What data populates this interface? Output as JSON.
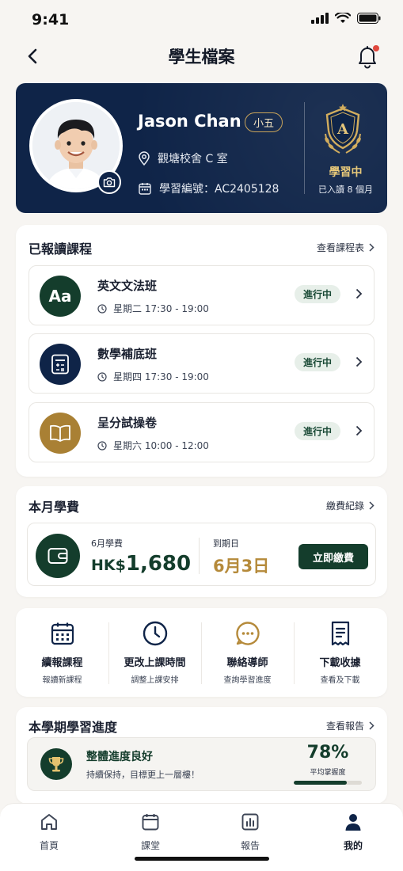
{
  "status_bar": {
    "time": "9:41"
  },
  "nav": {
    "title": "學生檔案"
  },
  "profile": {
    "name": "Jason Chan",
    "grade": "小五",
    "campus": "觀塘校舍 C 室",
    "student_id": "學習編號：AC2405128",
    "status": "學習中",
    "enrolled": "已入讀 8 個月"
  },
  "courses": {
    "title": "已報讀課程",
    "link": "查看課程表",
    "items": [
      {
        "icon_text": "Aa",
        "name": "英文文法班",
        "time": "星期二 17:30 - 19:00",
        "status": "進行中",
        "color": "#143d2c"
      },
      {
        "name": "數學補底班",
        "time": "星期四 17:30 - 19:00",
        "status": "進行中",
        "color": "#0f2448"
      },
      {
        "name": "呈分試操卷",
        "time": "星期六 10:00 - 12:00",
        "status": "進行中",
        "color": "#a98034"
      }
    ]
  },
  "fees": {
    "title": "本月學費",
    "link": "繳費紀錄",
    "month_label": "6月學費",
    "currency": "HK$",
    "amount": "1,680",
    "due_label": "到期日",
    "due_date": "6月3日",
    "pay_label": "立即繳費"
  },
  "actions": [
    {
      "title": "續報課程",
      "sub": "報讀新課程",
      "icon": "calendar-icon"
    },
    {
      "title": "更改上課時間",
      "sub": "調整上課安排",
      "icon": "clock-icon"
    },
    {
      "title": "聯絡導師",
      "sub": "查詢學習進度",
      "icon": "chat-icon"
    },
    {
      "title": "下載收據",
      "sub": "查看及下載",
      "icon": "receipt-icon"
    }
  ],
  "progress": {
    "title": "本學期學習進度",
    "link": "查看報告",
    "headline": "整體進度良好",
    "sub": "持續保持，目標更上一層樓！",
    "percent_text": "78%",
    "percent_value": 0.78,
    "percent_label": "平均掌握度"
  },
  "tabs": [
    {
      "label": "首頁"
    },
    {
      "label": "課堂"
    },
    {
      "label": "報告"
    },
    {
      "label": "我的"
    }
  ],
  "colors": {
    "navy": "#0f2448",
    "green": "#143d2c",
    "gold": "#b58a3a"
  }
}
